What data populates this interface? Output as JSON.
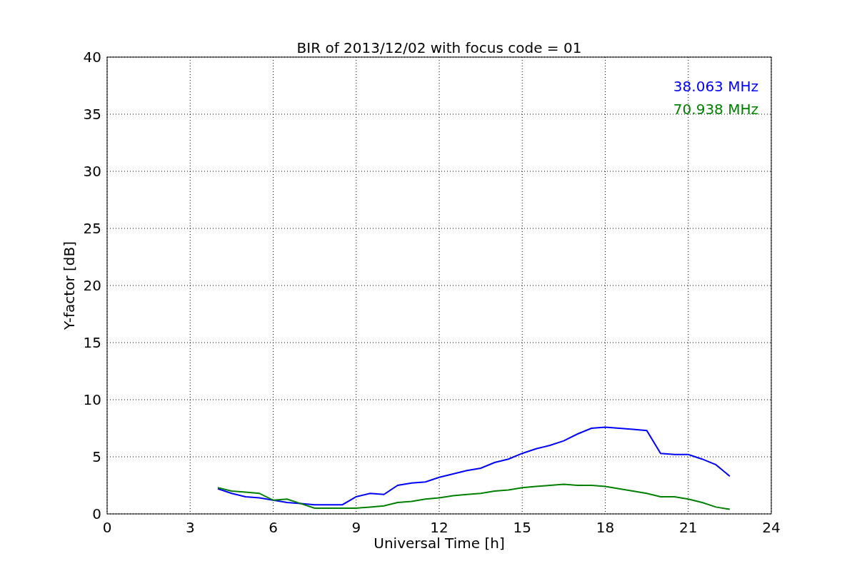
{
  "chart_data": {
    "type": "line",
    "title": "BIR of 2013/12/02 with focus code = 01",
    "xlabel": "Universal Time [h]",
    "ylabel": "Y-factor [dB]",
    "x": [
      4,
      4.5,
      5,
      5.5,
      6,
      6.5,
      7,
      7.5,
      8,
      8.5,
      9,
      9.5,
      10,
      10.5,
      11,
      11.5,
      12,
      12.5,
      13,
      13.5,
      14,
      14.5,
      15,
      15.5,
      16,
      16.5,
      17,
      17.5,
      18,
      18.5,
      19,
      19.5,
      20,
      20.5,
      21,
      21.5,
      22,
      22.5
    ],
    "series": [
      {
        "name": "38.063 MHz",
        "color": "#0000ff",
        "values": [
          2.2,
          1.8,
          1.5,
          1.4,
          1.2,
          1.0,
          0.9,
          0.8,
          0.8,
          0.8,
          1.5,
          1.8,
          1.7,
          2.5,
          2.7,
          2.8,
          3.2,
          3.5,
          3.8,
          4.0,
          4.5,
          4.8,
          5.3,
          5.7,
          6.0,
          6.4,
          7.0,
          7.5,
          7.6,
          7.5,
          7.4,
          7.3,
          5.3,
          5.2,
          5.2,
          4.8,
          4.3,
          3.3
        ]
      },
      {
        "name": "70.938 MHz",
        "color": "#008000",
        "values": [
          2.3,
          2.0,
          1.9,
          1.8,
          1.2,
          1.3,
          0.9,
          0.5,
          0.5,
          0.5,
          0.5,
          0.6,
          0.7,
          1.0,
          1.1,
          1.3,
          1.4,
          1.6,
          1.7,
          1.8,
          2.0,
          2.1,
          2.3,
          2.4,
          2.5,
          2.6,
          2.5,
          2.5,
          2.4,
          2.2,
          2.0,
          1.8,
          1.5,
          1.5,
          1.3,
          1.0,
          0.6,
          0.4
        ]
      }
    ],
    "xlim": [
      0,
      24
    ],
    "ylim": [
      0,
      40
    ],
    "xticks": [
      0,
      3,
      6,
      9,
      12,
      15,
      18,
      21,
      24
    ],
    "yticks": [
      0,
      5,
      10,
      15,
      20,
      25,
      30,
      35,
      40
    ],
    "grid": true
  }
}
